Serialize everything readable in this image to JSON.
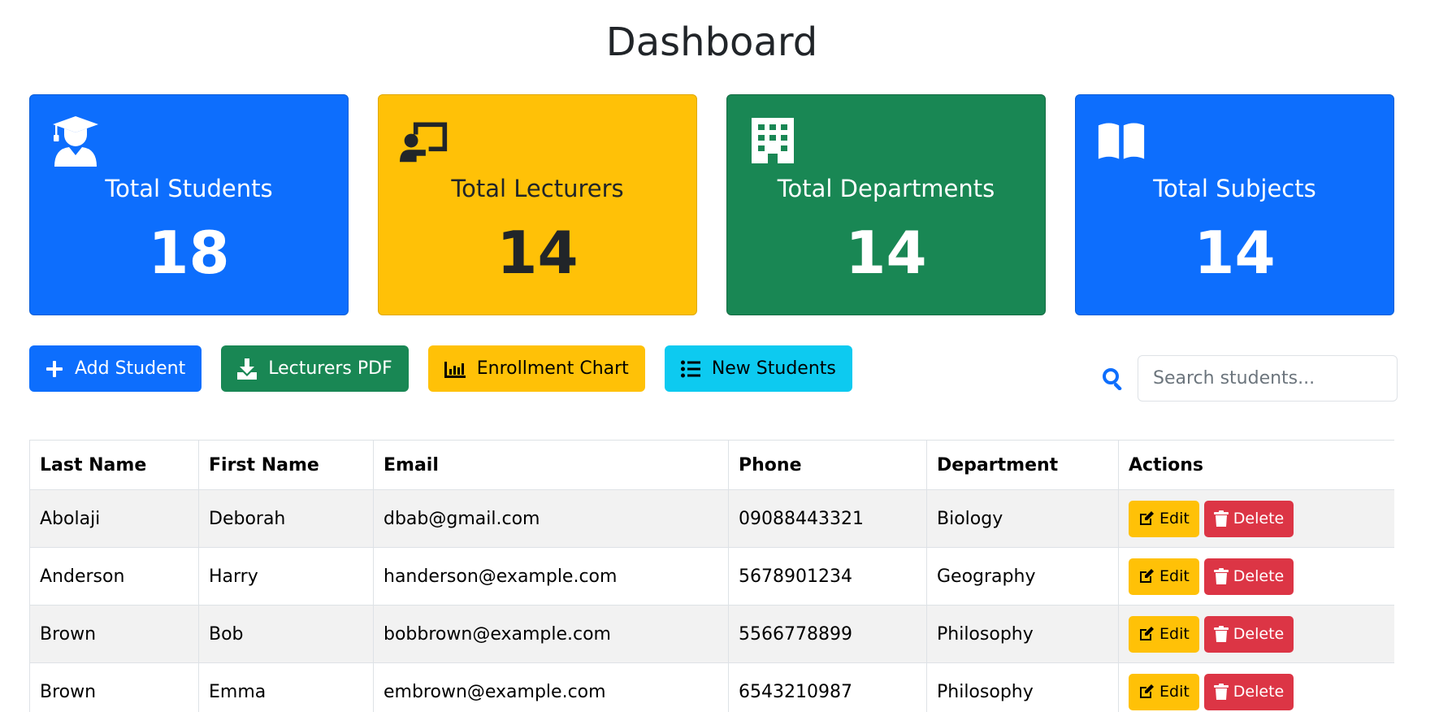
{
  "page": {
    "title": "Dashboard"
  },
  "cards": [
    {
      "label": "Total Students",
      "value": "18",
      "icon": "user-graduate-icon",
      "color": "#0d6efd"
    },
    {
      "label": "Total Lecturers",
      "value": "14",
      "icon": "chalkboard-teacher-icon",
      "color": "#ffc107"
    },
    {
      "label": "Total Departments",
      "value": "14",
      "icon": "building-icon",
      "color": "#198754"
    },
    {
      "label": "Total Subjects",
      "value": "14",
      "icon": "book-open-icon",
      "color": "#0d6efd"
    }
  ],
  "toolbar": {
    "add_student": "Add Student",
    "lecturers_pdf": "Lecturers PDF",
    "enrollment_chart": "Enrollment Chart",
    "new_students": "New Students"
  },
  "search": {
    "placeholder": "Search students..."
  },
  "table": {
    "headers": [
      "Last Name",
      "First Name",
      "Email",
      "Phone",
      "Department",
      "Actions"
    ],
    "edit_label": "Edit",
    "delete_label": "Delete",
    "rows": [
      {
        "last": "Abolaji",
        "first": "Deborah",
        "email": "dbab@gmail.com",
        "phone": "09088443321",
        "department": "Biology"
      },
      {
        "last": "Anderson",
        "first": "Harry",
        "email": "handerson@example.com",
        "phone": "5678901234",
        "department": "Geography"
      },
      {
        "last": "Brown",
        "first": "Bob",
        "email": "bobbrown@example.com",
        "phone": "5566778899",
        "department": "Philosophy"
      },
      {
        "last": "Brown",
        "first": "Emma",
        "email": "embrown@example.com",
        "phone": "6543210987",
        "department": "Philosophy"
      }
    ]
  }
}
